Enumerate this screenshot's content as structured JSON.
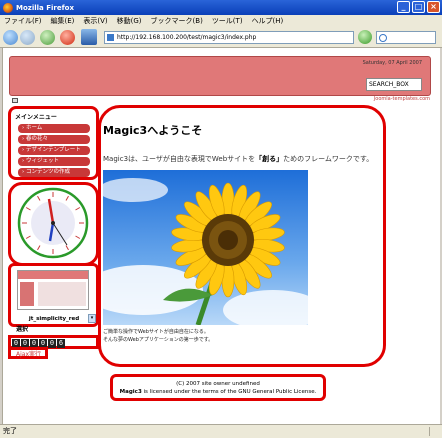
{
  "window": {
    "title": "Mozilla Firefox"
  },
  "menubar": [
    "ファイル(F)",
    "編集(E)",
    "表示(V)",
    "移動(G)",
    "ブックマーク(B)",
    "ツール(T)",
    "ヘルプ(H)"
  ],
  "address": {
    "url": "http://192.168.100.200/test/magic3/index.php"
  },
  "header": {
    "date": "Saturday, 07 April 2007",
    "search_value": "SEARCH_BOX",
    "credit": "Joomla-templates.com"
  },
  "sidebar": {
    "menu_title": "メインメニュー",
    "items": [
      "ホーム",
      "春の花々",
      "デザインテンプレート",
      "ウィジェット",
      "コンテンツの作成"
    ],
    "theme_name": "jt_simplicity_red",
    "theme_label": "選択",
    "counter": [
      "0",
      "0",
      "0",
      "0",
      "0",
      "6"
    ],
    "ajax_label": "Ajax実行"
  },
  "main": {
    "title": "Magic3へようこそ",
    "lead_before": "Magic3は、ユーザが自由な表現でWebサイトを",
    "lead_bold": "「創る」",
    "lead_after": "ためのフレームワークです。",
    "caption_line1": "ご簡単な操作でWebサイトが自由自在になる。",
    "caption_line2": "そんな夢のWebアプリケーションの第一歩です。"
  },
  "footer": {
    "line1": "(C) 2007 site owner undefined",
    "line2_bold": "Magic3",
    "line2_rest": " is licensed under the terms of the GNU General Public License."
  },
  "status": {
    "text": "完了"
  },
  "colors": {
    "highlight": "#e00000",
    "accent": "#c83838",
    "header": "#e07878"
  }
}
